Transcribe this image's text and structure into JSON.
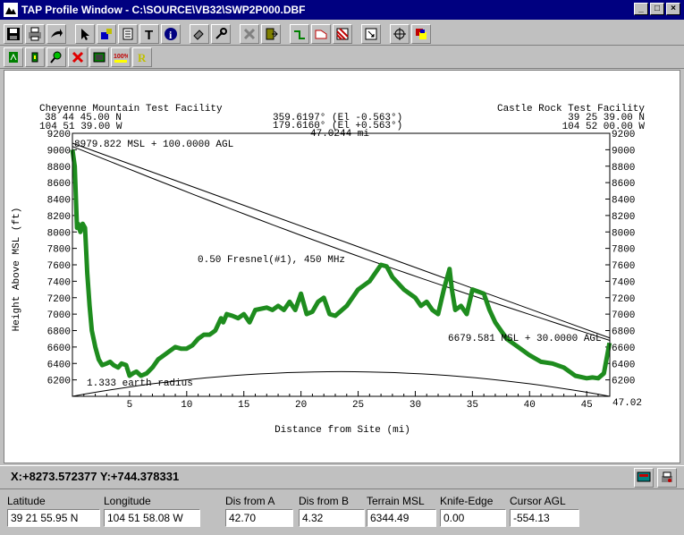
{
  "window": {
    "title": "TAP Profile Window - C:\\SOURCE\\VB32\\SWP2P000.DBF"
  },
  "toolbar1": [
    "save-icon",
    "print-icon",
    "export-icon",
    "pointer-icon",
    "paint-icon",
    "table-icon",
    "text-icon",
    "info-icon",
    "tool-icon",
    "wrench-icon",
    "delete-icon",
    "door-icon",
    "path-green-icon",
    "path-red-icon",
    "stripe-icon",
    "zoom-icon",
    "crosshair-icon",
    "color-icon"
  ],
  "toolbar2": [
    "green-icon",
    "sat-icon",
    "magnify-icon",
    "x-icon",
    "image-icon",
    "percent-icon",
    "r-icon"
  ],
  "chart_data": {
    "type": "line",
    "site_a": {
      "name": "Cheyenne Mountain Test Facility",
      "lat": "38 44 45.00 N",
      "lon": "104 51 39.00 W"
    },
    "site_b": {
      "name": "Castle Rock Test Facility",
      "lat": "39 25 39.00 N",
      "lon": "104 52 00.00 W"
    },
    "azimuth_a": "359.6197° (El -0.563°)",
    "azimuth_b": "179.6160° (El +0.563°)",
    "distance": "47.0244 mi",
    "antenna_a": "8979.822 MSL + 100.0000 AGL",
    "antenna_b": "6679.581 MSL + 30.0000 AGL",
    "fresnel_label": "0.50 Fresnel(#1), 450 MHz",
    "earth_label": "1.333 earth radius",
    "xlabel": "Distance from Site (mi)",
    "ylabel": "Height Above MSL (ft)",
    "x_end_label": "47.02",
    "xlim": [
      0,
      47.02
    ],
    "ylim": [
      6000,
      9200
    ],
    "xticks": [
      5,
      10,
      15,
      20,
      25,
      30,
      35,
      40,
      45
    ],
    "yticks": [
      6200,
      6400,
      6600,
      6800,
      7000,
      7200,
      7400,
      7600,
      7800,
      8000,
      8200,
      8400,
      8600,
      8800,
      9000,
      9200
    ],
    "terrain": {
      "x": [
        0,
        0.2,
        0.4,
        0.5,
        0.7,
        0.9,
        1.1,
        1.3,
        1.5,
        1.7,
        2,
        2.3,
        2.6,
        3,
        3.3,
        3.6,
        4,
        4.3,
        4.7,
        5,
        5.3,
        5.6,
        6,
        6.5,
        7,
        7.5,
        8,
        8.5,
        9,
        9.5,
        10,
        10.5,
        11,
        11.5,
        12,
        12.5,
        13,
        13.2,
        13.5,
        14,
        14.5,
        15,
        15.5,
        16,
        17,
        17.5,
        18,
        18.5,
        19,
        19.5,
        20,
        20.5,
        21,
        21.5,
        22,
        22.5,
        23,
        24,
        25,
        26,
        27,
        27.5,
        28,
        29,
        30,
        30.5,
        31,
        31.5,
        32,
        32.5,
        33,
        33.2,
        33.5,
        34,
        34.5,
        35,
        36,
        36.5,
        37,
        38,
        39,
        40,
        41,
        42,
        43,
        44,
        45,
        45.5,
        46,
        46.5,
        47
      ],
      "y": [
        9000,
        8800,
        8050,
        8100,
        8000,
        8100,
        8050,
        7500,
        7100,
        6800,
        6600,
        6450,
        6380,
        6400,
        6420,
        6380,
        6350,
        6400,
        6380,
        6250,
        6280,
        6300,
        6250,
        6280,
        6350,
        6450,
        6500,
        6550,
        6600,
        6580,
        6580,
        6620,
        6700,
        6750,
        6750,
        6800,
        6950,
        6900,
        7000,
        6980,
        6950,
        7000,
        6900,
        7050,
        7080,
        7050,
        7100,
        7050,
        7150,
        7050,
        7250,
        7000,
        7030,
        7150,
        7200,
        7000,
        6980,
        7100,
        7300,
        7400,
        7600,
        7580,
        7450,
        7300,
        7200,
        7100,
        7150,
        7050,
        7000,
        7300,
        7550,
        7300,
        7050,
        7100,
        7000,
        7300,
        7250,
        7050,
        6900,
        6700,
        6600,
        6500,
        6420,
        6400,
        6350,
        6250,
        6220,
        6230,
        6220,
        6280,
        6650
      ]
    }
  },
  "status": {
    "coords": "X:+8273.572377 Y:+744.378331"
  },
  "fields": [
    {
      "label": "Latitude",
      "value": "39 21 55.95 N"
    },
    {
      "label": "Longitude",
      "value": "104 51 58.08 W"
    },
    {
      "label": "Dis from A",
      "value": "42.70"
    },
    {
      "label": "Dis from B",
      "value": "4.32"
    },
    {
      "label": "Terrain MSL",
      "value": "6344.49"
    },
    {
      "label": "Knife-Edge",
      "value": "0.00"
    },
    {
      "label": "Cursor AGL",
      "value": "-554.13"
    }
  ]
}
